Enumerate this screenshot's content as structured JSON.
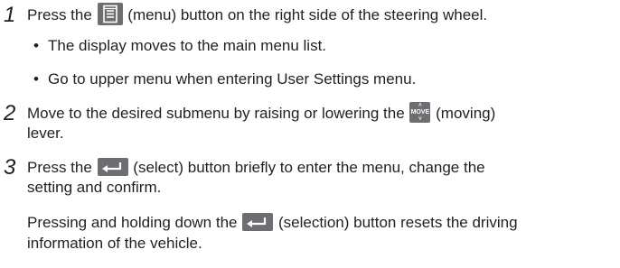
{
  "steps": [
    {
      "number": "1",
      "before_icon": "Press the",
      "icon": "menu-list-icon",
      "after_icon": "(menu) button on the right side of the steering wheel.",
      "bullets": [
        "The display moves to the main menu list.",
        "Go to upper menu when entering User Settings menu."
      ]
    },
    {
      "number": "2",
      "before_icon": "Move to the desired submenu by raising or lowering the",
      "icon": "move-lever-icon",
      "icon_label": "MOVE",
      "after_icon": "(moving)",
      "line2": "lever."
    },
    {
      "number": "3",
      "before_icon": "Press the",
      "icon": "enter-arrow-icon",
      "after_icon": "(select) button briefly to enter the menu, change the",
      "line2": "setting and confirm.",
      "note_before_icon": "Pressing and holding down the",
      "note_icon": "enter-arrow-icon",
      "note_after_icon": "(selection) button resets the driving",
      "note_line2": "information of the vehicle."
    }
  ],
  "colors": {
    "text": "#231f20",
    "icon_bg": "#6d6e71",
    "icon_fg": "#ffffff"
  }
}
